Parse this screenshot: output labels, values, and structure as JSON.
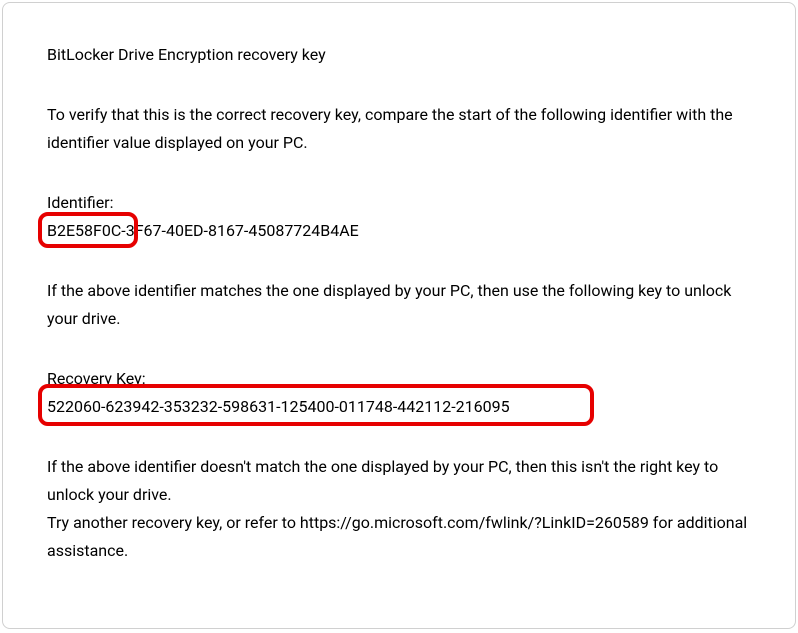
{
  "title": "BitLocker Drive Encryption recovery key",
  "verify_text": "To verify that this is the correct recovery key, compare the start of the following identifier with the identifier value displayed on your PC.",
  "identifier_label": "Identifier:",
  "identifier_value": "B2E58F0C-3F67-40ED-8167-45087724B4AE",
  "match_text": "If the above identifier matches the one displayed by your PC, then use the following key to unlock your drive.",
  "recovery_label": "Recovery Key:",
  "recovery_value": "522060-623942-353232-598631-125400-011748-442112-216095",
  "nomatch_text": "If the above identifier doesn't match the one displayed by your PC, then this isn't the right key to unlock your drive.",
  "assist_text": "Try another recovery key, or refer to https://go.microsoft.com/fwlink/?LinkID=260589 for additional assistance."
}
